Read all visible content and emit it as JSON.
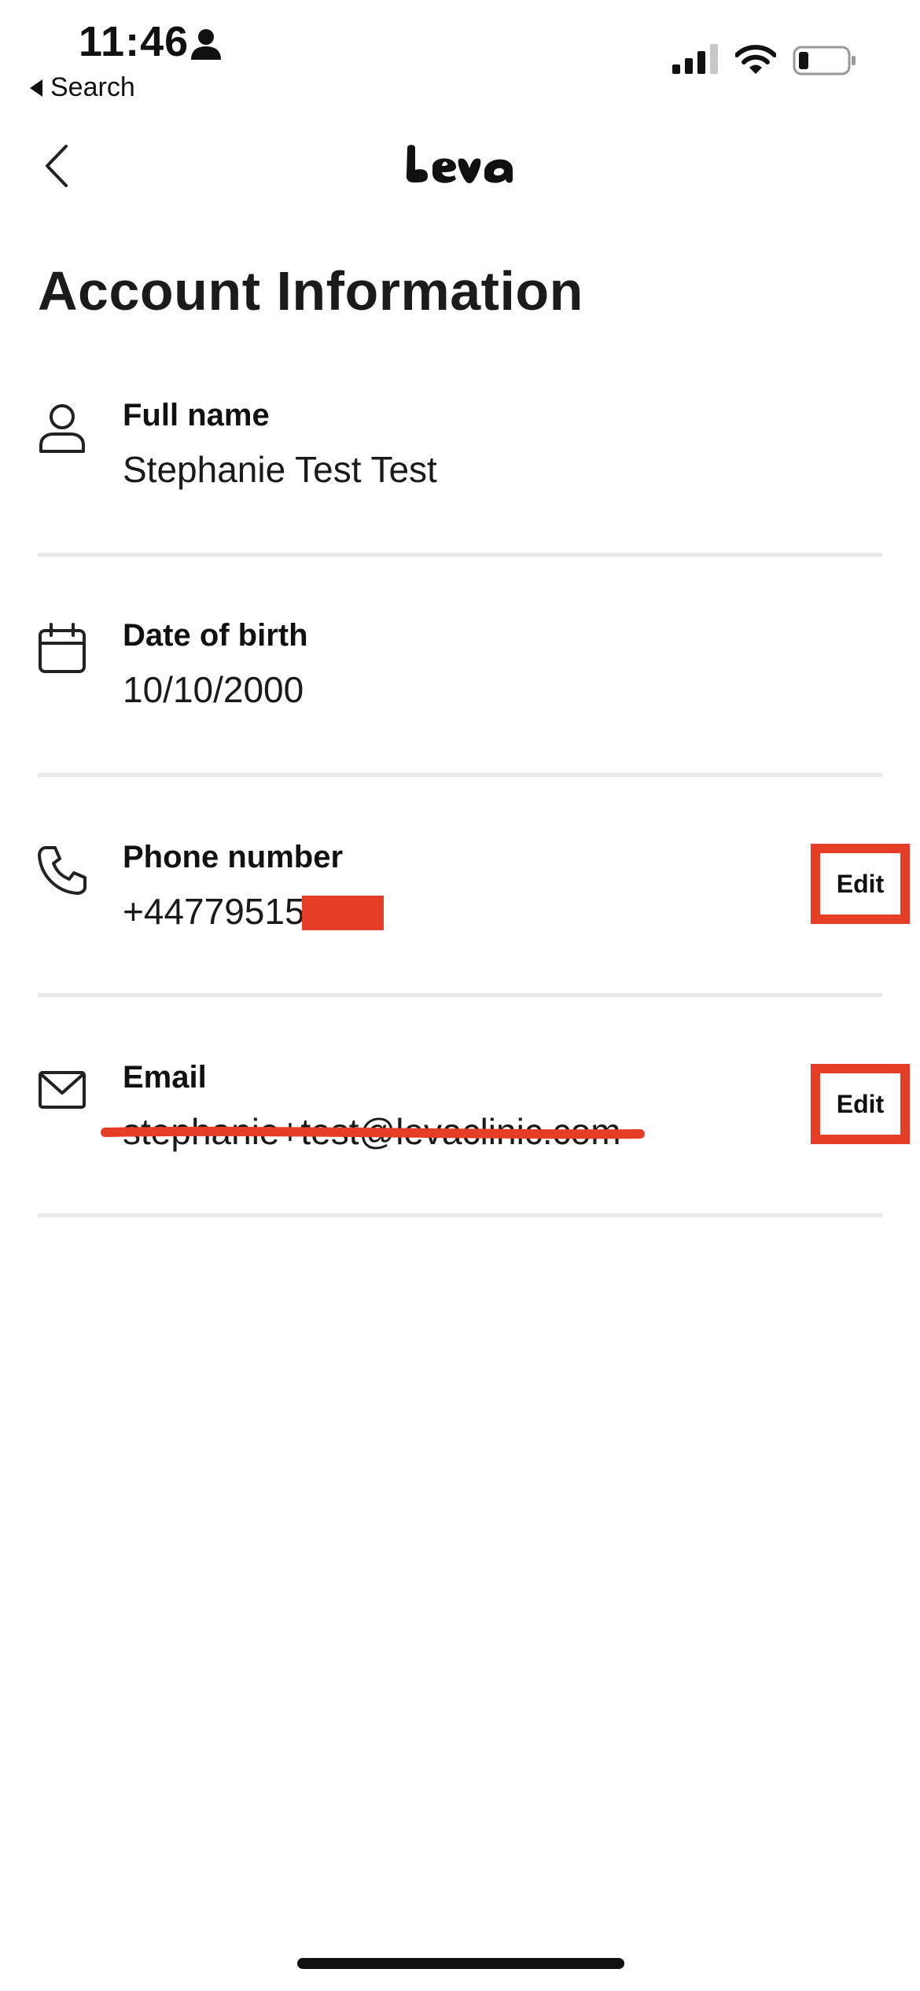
{
  "status_bar": {
    "time": "11:46",
    "back_app_label": "Search",
    "icons": [
      "person-icon",
      "cellular-signal-icon",
      "wifi-icon",
      "battery-icon"
    ]
  },
  "nav": {
    "back_icon": "chevron-left-icon",
    "brand": "Leva"
  },
  "page": {
    "title": "Account Information"
  },
  "fields": [
    {
      "icon": "person-icon",
      "label": "Full name",
      "value": "Stephanie Test Test",
      "editable": false
    },
    {
      "icon": "calendar-icon",
      "label": "Date of birth",
      "value": "10/10/2000",
      "editable": false
    },
    {
      "icon": "phone-icon",
      "label": "Phone number",
      "value": "+44779515",
      "editable": true,
      "edit_label": "Edit",
      "redacted": true
    },
    {
      "icon": "envelope-icon",
      "label": "Email",
      "value": "stephanie+test@levaclinic.com",
      "editable": true,
      "edit_label": "Edit",
      "redacted": true
    }
  ],
  "colors": {
    "accent_red": "#e53d26",
    "divider": "#e8e8e8",
    "text": "#1a1a1a",
    "background": "#ffffff"
  }
}
